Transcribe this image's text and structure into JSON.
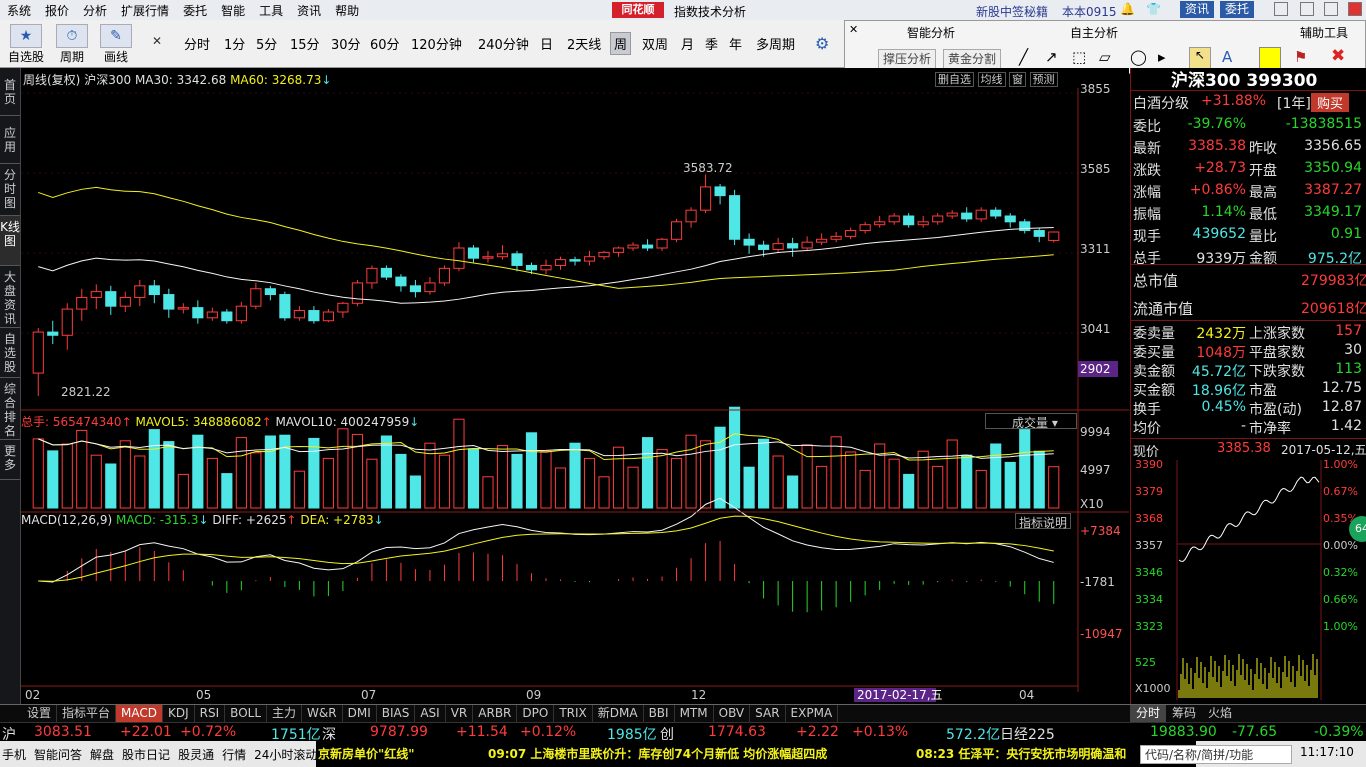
{
  "menu": {
    "items": [
      "系统",
      "报价",
      "分析",
      "扩展行情",
      "委托",
      "智能",
      "工具",
      "资讯",
      "帮助"
    ],
    "brand": "同花顺",
    "title": "指数技术分析",
    "news": "新股中签秘籍",
    "user": "本本0915",
    "btn_zixun": "资讯",
    "btn_weituo": "委托"
  },
  "toolbar": {
    "tool_labels": [
      "自选股",
      "周期",
      "画线"
    ],
    "periods": [
      "分时",
      "1分",
      "5分",
      "15分",
      "30分",
      "60分",
      "120分钟",
      "240分钟",
      "日",
      "2天线",
      "周",
      "双周",
      "月",
      "季",
      "年",
      "多周期"
    ],
    "selected_period": "周"
  },
  "popup": {
    "section1": "智能分析",
    "section2": "自主分析",
    "section3": "辅助工具",
    "btn1": "撑压分析",
    "btn2": "黄金分割"
  },
  "left_tabs": [
    "首页",
    "应用",
    "分时图",
    "K线图",
    "大盘资讯",
    "自选股",
    "综合排名",
    "更多"
  ],
  "chart": {
    "main_header": {
      "prefix": "周线(复权)",
      "name": "沪深300",
      "ma30": "MA30: 3342.68",
      "ma60": "MA60: 3268.73"
    },
    "right_tabs": [
      "删自选",
      "均线",
      "窗",
      "预测"
    ],
    "y_axis_main": [
      "3855",
      "3585",
      "3311",
      "3041"
    ],
    "current_price_label": "2902",
    "high_label": "3583.72",
    "low_label": "2821.22",
    "vol_header": {
      "total": "总手: 565474340",
      "mavol5": "MAVOL5: 348886082",
      "mavol10": "MAVOL10: 400247959"
    },
    "vol_selector": "成交量",
    "vol_axis": [
      "9994",
      "4997",
      "X10"
    ],
    "macd_header": {
      "params": "MACD(12,26,9)",
      "macd": "MACD: -315.3",
      "diff": "DIFF: +2625",
      "dea": "DEA: +2783"
    },
    "macd_button": "指标说明",
    "macd_axis": [
      "+7384",
      "-1781",
      "-10947"
    ],
    "x_axis": [
      "02",
      "05",
      "07",
      "09",
      "12",
      "04"
    ],
    "date_marker": "2017-02-17,五"
  },
  "chart_data": {
    "type": "candlestick",
    "title": "沪深300",
    "ylim": [
      2821,
      3855
    ],
    "candles": [
      [
        2900,
        3041,
        2821,
        3055
      ],
      [
        3041,
        3030,
        3000,
        3080
      ],
      [
        3030,
        3120,
        2980,
        3140
      ],
      [
        3120,
        3160,
        3080,
        3190
      ],
      [
        3160,
        3180,
        3120,
        3205
      ],
      [
        3180,
        3130,
        3100,
        3200
      ],
      [
        3130,
        3160,
        3110,
        3180
      ],
      [
        3160,
        3200,
        3130,
        3220
      ],
      [
        3200,
        3170,
        3140,
        3220
      ],
      [
        3170,
        3120,
        3090,
        3190
      ],
      [
        3120,
        3125,
        3105,
        3140
      ],
      [
        3125,
        3090,
        3070,
        3150
      ],
      [
        3090,
        3110,
        3080,
        3125
      ],
      [
        3110,
        3080,
        3070,
        3120
      ],
      [
        3080,
        3130,
        3070,
        3145
      ],
      [
        3130,
        3190,
        3120,
        3210
      ],
      [
        3190,
        3170,
        3150,
        3200
      ],
      [
        3170,
        3090,
        3080,
        3180
      ],
      [
        3090,
        3115,
        3080,
        3130
      ],
      [
        3115,
        3080,
        3070,
        3130
      ],
      [
        3080,
        3110,
        3075,
        3120
      ],
      [
        3110,
        3140,
        3090,
        3145
      ],
      [
        3140,
        3210,
        3130,
        3220
      ],
      [
        3210,
        3260,
        3190,
        3270
      ],
      [
        3260,
        3230,
        3220,
        3270
      ],
      [
        3230,
        3200,
        3180,
        3240
      ],
      [
        3200,
        3180,
        3160,
        3220
      ],
      [
        3180,
        3210,
        3170,
        3230
      ],
      [
        3210,
        3260,
        3200,
        3270
      ],
      [
        3260,
        3330,
        3250,
        3350
      ],
      [
        3330,
        3295,
        3280,
        3340
      ],
      [
        3295,
        3300,
        3280,
        3320
      ],
      [
        3300,
        3310,
        3290,
        3340
      ],
      [
        3310,
        3270,
        3250,
        3320
      ],
      [
        3270,
        3255,
        3240,
        3280
      ],
      [
        3255,
        3270,
        3240,
        3290
      ],
      [
        3270,
        3290,
        3255,
        3300
      ],
      [
        3290,
        3285,
        3270,
        3300
      ],
      [
        3285,
        3300,
        3270,
        3320
      ],
      [
        3300,
        3315,
        3290,
        3320
      ],
      [
        3315,
        3330,
        3300,
        3335
      ],
      [
        3330,
        3340,
        3320,
        3350
      ],
      [
        3340,
        3330,
        3320,
        3360
      ],
      [
        3330,
        3360,
        3320,
        3365
      ],
      [
        3360,
        3420,
        3350,
        3430
      ],
      [
        3420,
        3460,
        3400,
        3470
      ],
      [
        3460,
        3540,
        3450,
        3583
      ],
      [
        3540,
        3510,
        3480,
        3550
      ],
      [
        3510,
        3360,
        3340,
        3530
      ],
      [
        3360,
        3340,
        3310,
        3380
      ],
      [
        3340,
        3325,
        3300,
        3355
      ],
      [
        3325,
        3345,
        3315,
        3365
      ],
      [
        3345,
        3330,
        3300,
        3365
      ],
      [
        3330,
        3350,
        3320,
        3370
      ],
      [
        3350,
        3360,
        3340,
        3380
      ],
      [
        3360,
        3370,
        3350,
        3385
      ],
      [
        3370,
        3390,
        3360,
        3400
      ],
      [
        3390,
        3410,
        3380,
        3420
      ],
      [
        3410,
        3420,
        3400,
        3440
      ],
      [
        3420,
        3440,
        3410,
        3450
      ],
      [
        3440,
        3410,
        3400,
        3450
      ],
      [
        3410,
        3420,
        3400,
        3440
      ],
      [
        3420,
        3440,
        3410,
        3450
      ],
      [
        3440,
        3450,
        3430,
        3460
      ],
      [
        3450,
        3430,
        3420,
        3470
      ],
      [
        3430,
        3460,
        3420,
        3470
      ],
      [
        3460,
        3440,
        3430,
        3470
      ],
      [
        3440,
        3420,
        3400,
        3450
      ],
      [
        3420,
        3390,
        3380,
        3430
      ],
      [
        3390,
        3370,
        3350,
        3400
      ],
      [
        3356,
        3385,
        3349,
        3387
      ]
    ]
  },
  "right": {
    "title": "沪深300 399300",
    "r1": {
      "k": "白酒分级",
      "v": "+31.88%",
      "t": "[1年]",
      "btn": "购买"
    },
    "rows": [
      [
        "委比",
        "-39.76%",
        "",
        "-13838515"
      ],
      [
        "最新",
        "3385.38",
        "昨收",
        "3356.65"
      ],
      [
        "涨跌",
        "+28.73",
        "开盘",
        "3350.94"
      ],
      [
        "涨幅",
        "+0.86%",
        "最高",
        "3387.27"
      ],
      [
        "振幅",
        "1.14%",
        "最低",
        "3349.17"
      ],
      [
        "现手",
        "439652",
        "量比",
        "0.91"
      ],
      [
        "总手",
        "9339万",
        "金额",
        "975.2亿"
      ]
    ],
    "big": [
      [
        "总市值",
        "279983亿"
      ],
      [
        "流通市值",
        "209618亿"
      ]
    ],
    "stats": [
      [
        "委卖量",
        "2432万",
        "上涨家数",
        "157"
      ],
      [
        "委买量",
        "1048万",
        "平盘家数",
        "30"
      ],
      [
        "卖金额",
        "45.72亿",
        "下跌家数",
        "113"
      ],
      [
        "买金额",
        "18.96亿",
        "市盈",
        "12.75"
      ],
      [
        "换手",
        "0.45%",
        "市盈(动)",
        "12.87"
      ],
      [
        "均价",
        "-",
        "市净率",
        "1.42"
      ]
    ],
    "mini": {
      "price_label": "现价",
      "price": "3385.38",
      "date": "2017-05-12,五",
      "left_axis": [
        "3390",
        "3379",
        "3368",
        "3357",
        "3346",
        "3334",
        "3323",
        "525",
        "X1000"
      ],
      "right_axis": [
        "1.00%",
        "0.67%",
        "0.35%",
        "0.00%",
        "0.32%",
        "0.66%",
        "1.00%"
      ]
    },
    "tabs": [
      "分时",
      "筹码",
      "火焰"
    ],
    "badge": "64"
  },
  "bottom_tabs": [
    "设置",
    "指标平台",
    "MACD",
    "KDJ",
    "RSI",
    "BOLL",
    "主力",
    "W&R",
    "DMI",
    "BIAS",
    "ASI",
    "VR",
    "ARBR",
    "DPO",
    "TRIX",
    "新DMA",
    "BBI",
    "MTM",
    "OBV",
    "SAR",
    "EXPMA"
  ],
  "ticker": {
    "sh": "沪",
    "sh_val": "3083.51",
    "sh_chg": "+22.01",
    "sh_pct": "+0.72%",
    "sh_amt": "1751亿",
    "sz": "深",
    "sz_val": "9787.99",
    "sz_chg": "+11.54",
    "sz_pct": "+0.12%",
    "sz_amt": "1985亿",
    "cy": "创",
    "cy_val": "1774.63",
    "cy_chg": "+2.22",
    "cy_pct": "+0.13%",
    "cy_amt": "572.2亿",
    "rj": "日经225",
    "rj_val": "19883.90",
    "rj_chg": "-77.65",
    "rj_pct": "-0.39%"
  },
  "status": {
    "items": [
      "手机",
      "智能问答",
      "解盘",
      "股市日记",
      "股灵通",
      "行情",
      "24小时滚动"
    ],
    "news1": "京新房单价\"红线\"",
    "news2": "09:07 上海楼市里跌价升：库存创74个月新低 均价涨幅超四成",
    "news3": "08:23 任泽平：央行安抚市场明确温和",
    "search": "代码/名称/简拼/功能",
    "time": "11:17:10"
  }
}
